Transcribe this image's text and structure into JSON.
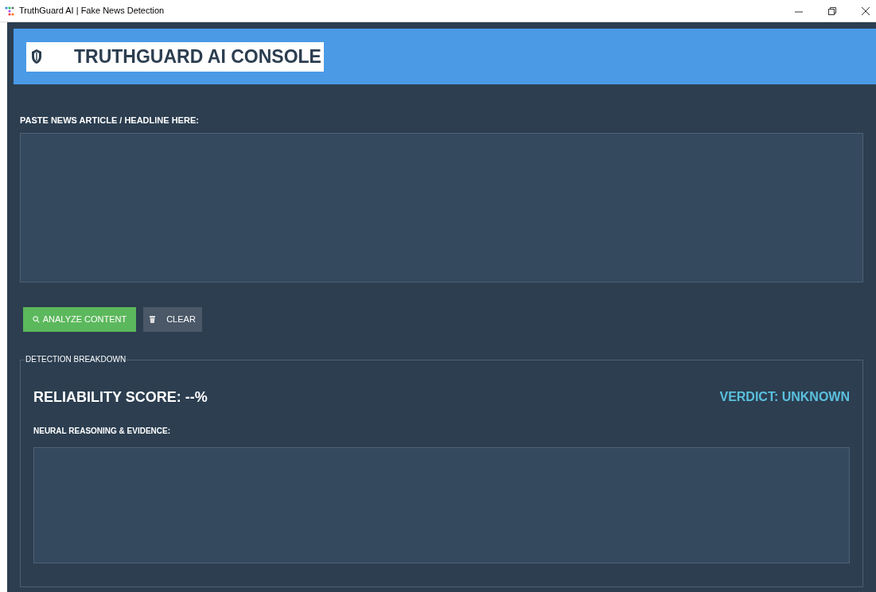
{
  "window": {
    "title": "TruthGuard AI | Fake News Detection"
  },
  "header": {
    "title": "TRUTHGUARD AI CONSOLE"
  },
  "input": {
    "label": "PASTE NEWS ARTICLE / HEADLINE HERE:"
  },
  "buttons": [
    {
      "kind": "analyze",
      "label": "ANALYZE CONTENT"
    },
    {
      "kind": "clear",
      "label": "CLEAR"
    }
  ],
  "breakdown": {
    "legend": "DETECTION BREAKDOWN",
    "score": "RELIABILITY SCORE: --%",
    "verdict": "VERDICT: UNKNOWN",
    "reasoning_label": "NEURAL REASONING & EVIDENCE:"
  }
}
